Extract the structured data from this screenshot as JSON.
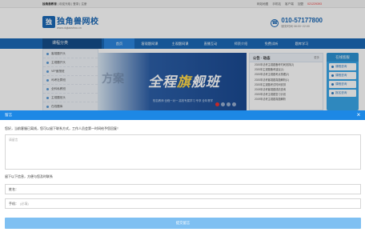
{
  "topbar": {
    "left_brand": "独角兽教育",
    "left_text": "|  欢迎光临  |  登录  |  注册",
    "links": [
      "网站地图",
      "手机站",
      "客户端",
      "加盟",
      "021229393"
    ]
  },
  "header": {
    "logo_mark": "独",
    "logo_name": "独角兽网校",
    "logo_url": "www.dujiaoshou.cn",
    "hotline_number": "010-57177800",
    "hotline_hours": "服务时间 08:00~22:00"
  },
  "nav": {
    "category_label": "课程分类",
    "items": [
      "首页",
      "客观题网课",
      "主观题网课",
      "直播互动",
      "师资介绍",
      "免费试听",
      "题库学习"
    ]
  },
  "categories": [
    "客观题开头",
    "主观题开头",
    "VIP面授班",
    "司考社群班",
    "全科私教班",
    "主观题班头",
    "在线题库"
  ],
  "banner": {
    "ghost_text": "方案",
    "headline_a": "全程",
    "headline_b": "旗",
    "headline_c": "舰班",
    "sub": "知名教师 全程一对一 高效专属学习 专享 全年督学"
  },
  "notice": {
    "title": "公告 · 动态",
    "more": "更多",
    "lines": [
      "2020年法考主观题备考时间安排(2)",
      "2020年主观题备考建议(1)",
      "2020年法考主观题考点梳理(2)",
      "2020年法考客观题真题解析(1)",
      "2020年主观题考试时间安排",
      "2019年法考客观题成绩查询",
      "2020年法考主观题复习计划",
      "2019年法考主观题真题解析"
    ]
  },
  "online": {
    "title": "在线客服",
    "buttons": [
      "课程咨询",
      "课程咨询",
      "课程咨询",
      "报名咨询"
    ]
  },
  "modal": {
    "title": "留言",
    "close": "×",
    "message": "您好，当前客服已离线，您可以留下联系方式，工作人员会第一时间给予您回复！",
    "textarea_placeholder": "请留言",
    "hint": "留下以下信息，方便与您及时联系",
    "name_label": "姓名：",
    "name_placeholder": "",
    "phone_label": "手机：",
    "phone_placeholder": "(必填)",
    "submit": "提交留言"
  }
}
